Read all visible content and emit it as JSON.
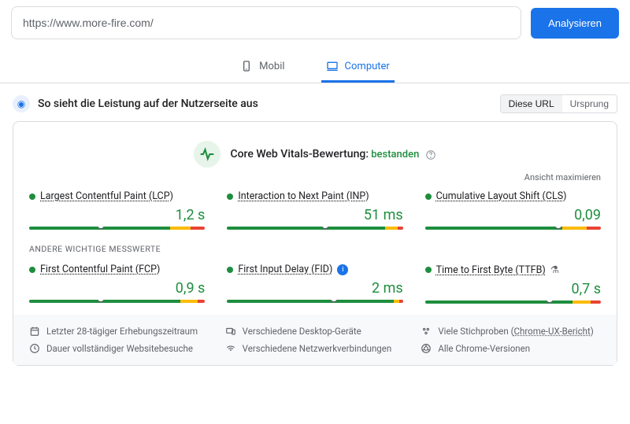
{
  "url_input": {
    "value": "https://www.more-fire.com/"
  },
  "analyze_label": "Analysieren",
  "tabs": {
    "mobile": "Mobil",
    "desktop": "Computer"
  },
  "section_title": "So sieht die Leistung auf der Nutzerseite aus",
  "source": {
    "url": "Diese URL",
    "origin": "Ursprung"
  },
  "cwv": {
    "title": "Core Web Vitals-Bewertung:",
    "status": "bestanden"
  },
  "maximize_label": "Ansicht maximieren",
  "metrics": {
    "lcp": {
      "name": "Largest Contentful Paint (LCP)",
      "value": "1,2 s",
      "good": 80,
      "ok": 12,
      "bad": 8,
      "marker": 40
    },
    "inp": {
      "name": "Interaction to Next Paint (INP)",
      "value": "51 ms",
      "good": 90,
      "ok": 7,
      "bad": 3,
      "marker": 55
    },
    "cls": {
      "name": "Cumulative Layout Shift (CLS)",
      "value": "0,09",
      "good": 78,
      "ok": 14,
      "bad": 8,
      "marker": 75
    }
  },
  "subhead": "ANDERE WICHTIGE MESSWERTE",
  "other_metrics": {
    "fcp": {
      "name": "First Contentful Paint (FCP)",
      "value": "0,9 s",
      "good": 86,
      "ok": 10,
      "bad": 4,
      "marker": 40
    },
    "fid": {
      "name": "First Input Delay (FID)",
      "value": "2 ms",
      "good": 95,
      "ok": 3,
      "bad": 2,
      "marker": 60
    },
    "ttfb": {
      "name": "Time to First Byte (TTFB)",
      "value": "0,7 s",
      "good": 84,
      "ok": 10,
      "bad": 6,
      "marker": 70
    }
  },
  "meta": {
    "period": "Letzter 28-tägiger Erhebungszeitraum",
    "devices": "Verschiedene Desktop-Geräte",
    "samples_pre": "Viele Stichproben (",
    "samples_link": "Chrome-UX-Bericht",
    "samples_post": ")",
    "session": "Dauer vollständiger Websitebesuche",
    "network": "Verschiedene Netzwerkverbindungen",
    "versions": "Alle Chrome-Versionen"
  }
}
